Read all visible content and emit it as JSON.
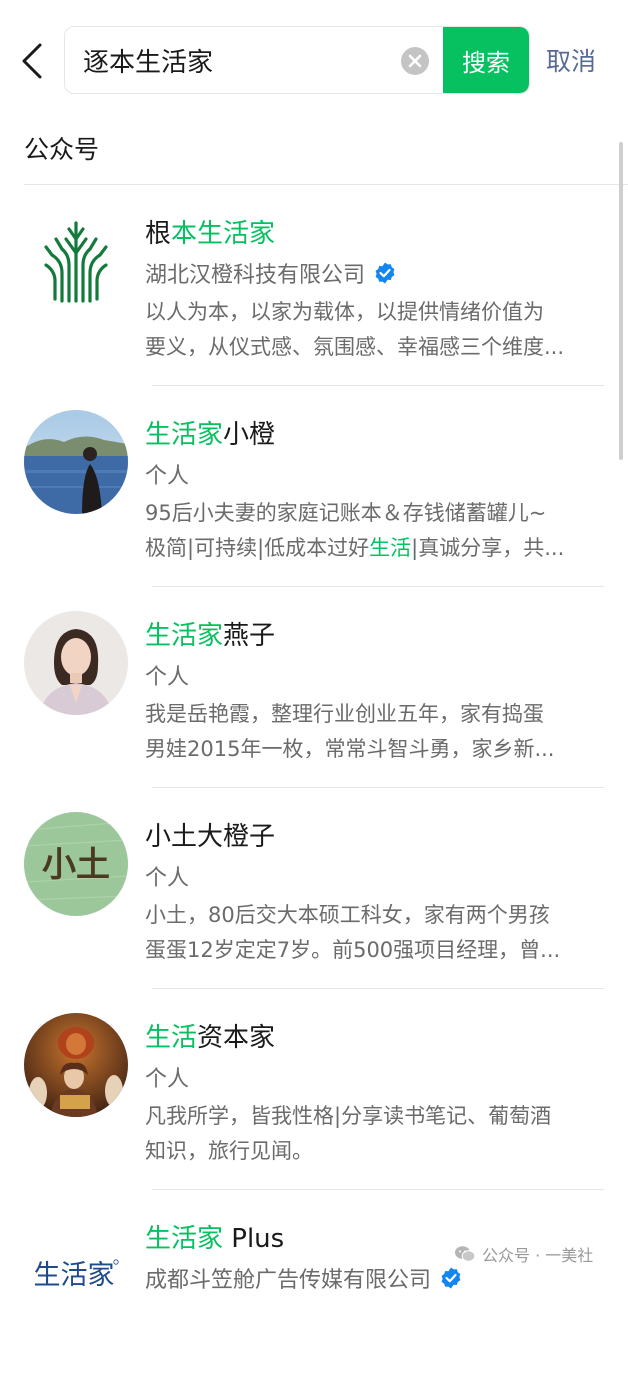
{
  "search": {
    "query": "逐本生活家",
    "button_label": "搜索",
    "cancel_label": "取消"
  },
  "section": {
    "title": "公众号"
  },
  "results": [
    {
      "name_pre": "根",
      "name_hl": "本生活家",
      "name_post": "",
      "sub": "湖北汉橙科技有限公司",
      "verified": true,
      "desc": [
        {
          "pre": "以人为本，以家为载体，以提供情绪价值为",
          "hl": "",
          "post": ""
        },
        {
          "pre": "要义，从仪式感、氛围感、幸福感三个维度...",
          "hl": "",
          "post": ""
        }
      ],
      "avatar_icon": "green-plant-logo"
    },
    {
      "name_pre": "",
      "name_hl": "生活家",
      "name_post": "小橙",
      "sub": "个人",
      "verified": false,
      "desc": [
        {
          "pre": "95后小夫妻的家庭记账本＆存钱储蓄罐儿~",
          "hl": "",
          "post": ""
        },
        {
          "pre": "极简|可持续|低成本过好",
          "hl": "生活",
          "post": "|真诚分享，共..."
        }
      ],
      "avatar_icon": "lakeside-photo"
    },
    {
      "name_pre": "",
      "name_hl": "生活家",
      "name_post": "燕子",
      "sub": "个人",
      "verified": false,
      "desc": [
        {
          "pre": "我是岳艳霞，整理行业创业五年，家有捣蛋",
          "hl": "",
          "post": ""
        },
        {
          "pre": "男娃2015年一枚，常常斗智斗勇，家乡新...",
          "hl": "",
          "post": ""
        }
      ],
      "avatar_icon": "portrait-photo"
    },
    {
      "name_pre": "小土大橙子",
      "name_hl": "",
      "name_post": "",
      "sub": "个人",
      "verified": false,
      "desc": [
        {
          "pre": "小土，80后交大本硕工科女，家有两个男孩",
          "hl": "",
          "post": ""
        },
        {
          "pre": "蛋蛋12岁定定7岁。前500强项目经理，曾...",
          "hl": "",
          "post": ""
        }
      ],
      "avatar_icon": "xiaotu-text-logo",
      "avatar_text": "小土"
    },
    {
      "name_pre": "",
      "name_hl": "生活",
      "name_post": "资本家",
      "sub": "个人",
      "verified": false,
      "desc": [
        {
          "pre": "凡我所学，皆我性格|分享读书笔记、葡萄酒",
          "hl": "",
          "post": ""
        },
        {
          "pre": "知识，旅行见闻。",
          "hl": "",
          "post": ""
        }
      ],
      "avatar_icon": "painting-photo"
    },
    {
      "name_pre": "",
      "name_hl": "生活家",
      "name_post": " Plus",
      "sub": "成都斗笠舱广告传媒有限公司",
      "verified": true,
      "desc": [],
      "avatar_icon": "shenghuojia-calligraphy-logo",
      "avatar_text": "生活家"
    }
  ],
  "watermark": {
    "text": "公众号 · 一美社"
  },
  "colors": {
    "accent": "#07c160",
    "link": "#576b95",
    "verified": "#1485ee",
    "secondary_text": "#6b6b6b"
  }
}
